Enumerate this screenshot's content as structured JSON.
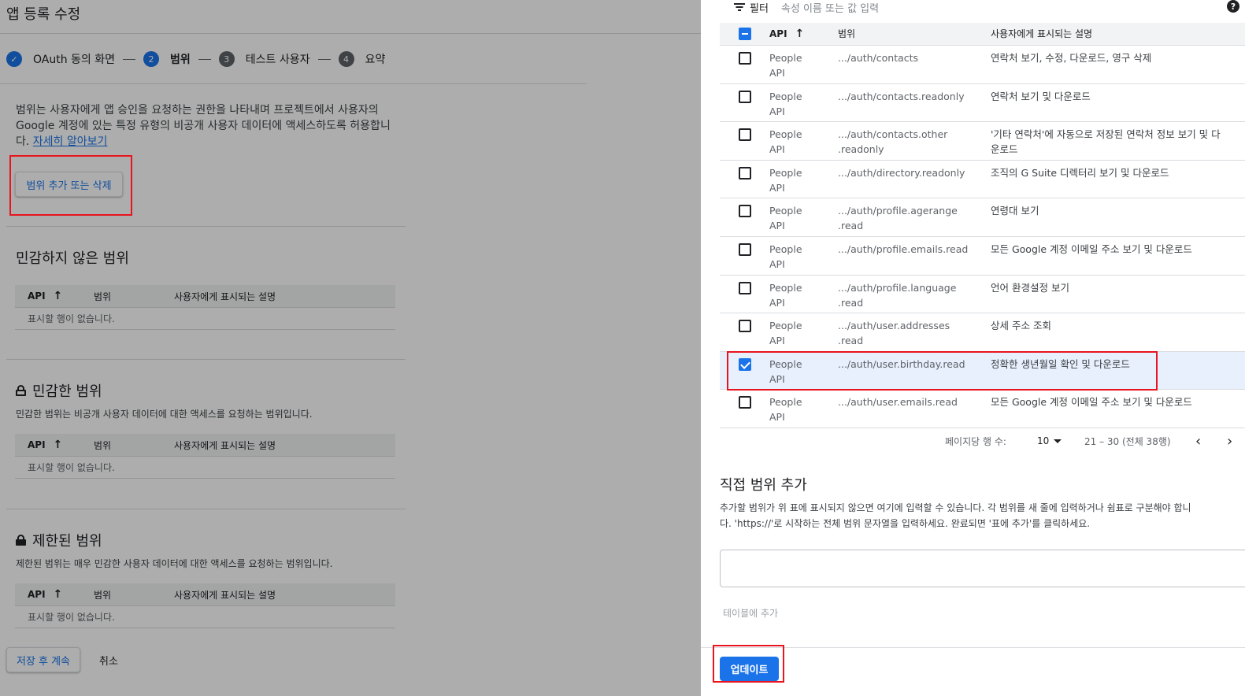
{
  "left": {
    "title": "앱 등록 수정",
    "steps": [
      {
        "num": "",
        "label": "OAuth 동의 화면",
        "state": "done"
      },
      {
        "num": "2",
        "label": "범위",
        "state": "active"
      },
      {
        "num": "3",
        "label": "테스트 사용자",
        "state": "todo"
      },
      {
        "num": "4",
        "label": "요약",
        "state": "todo"
      }
    ],
    "intro_text": "범위는 사용자에게 앱 승인을 요청하는 권한을 나타내며 프로젝트에서 사용자의 Google 계정에 있는 특정 유형의 비공개 사용자 데이터에 액세스하도록 허용합니다.",
    "learn_more": "자세히 알아보기",
    "add_remove_button": "범위 추가 또는 삭제",
    "table_headers": {
      "api": "API",
      "scope": "범위",
      "desc": "사용자에게 표시되는 설명"
    },
    "empty_text": "표시할 행이 없습니다.",
    "sections": {
      "non_sensitive": {
        "title": "민감하지 않은 범위",
        "desc": ""
      },
      "sensitive": {
        "title": "민감한 범위",
        "desc": "민감한 범위는 비공개 사용자 데이터에 대한 액세스를 요청하는 범위입니다."
      },
      "restricted": {
        "title": "제한된 범위",
        "desc": "제한된 범위는 매우 민감한 사용자 데이터에 대한 액세스를 요청하는 범위입니다."
      }
    },
    "save_button": "저장 후 계속",
    "cancel_button": "취소"
  },
  "panel": {
    "filter_label": "필터",
    "filter_placeholder": "속성 이름 또는 값 입력",
    "headers": {
      "api": "API",
      "scope": "범위",
      "desc": "사용자에게 표시되는 설명"
    },
    "rows": [
      {
        "api1": "People",
        "api2": "API",
        "scope1": ".../auth/contacts",
        "scope2": "",
        "desc1": "연락처 보기, 수정, 다운로드, 영구 삭제",
        "desc2": "",
        "checked": false
      },
      {
        "api1": "People",
        "api2": "API",
        "scope1": ".../auth/contacts.readonly",
        "scope2": "",
        "desc1": "연락처 보기 및 다운로드",
        "desc2": "",
        "checked": false
      },
      {
        "api1": "People",
        "api2": "API",
        "scope1": ".../auth/contacts.other",
        "scope2": ".readonly",
        "desc1": "'기타 연락처'에 자동으로 저장된 연락처 정보 보기 및 다",
        "desc2": "운로드",
        "checked": false
      },
      {
        "api1": "People",
        "api2": "API",
        "scope1": ".../auth/directory.readonly",
        "scope2": "",
        "desc1": "조직의 G Suite 디렉터리 보기 및 다운로드",
        "desc2": "",
        "checked": false
      },
      {
        "api1": "People",
        "api2": "API",
        "scope1": ".../auth/profile.agerange",
        "scope2": ".read",
        "desc1": "연령대 보기",
        "desc2": "",
        "checked": false
      },
      {
        "api1": "People",
        "api2": "API",
        "scope1": ".../auth/profile.emails.read",
        "scope2": "",
        "desc1": "모든 Google 계정 이메일 주소 보기 및 다운로드",
        "desc2": "",
        "checked": false
      },
      {
        "api1": "People",
        "api2": "API",
        "scope1": ".../auth/profile.language",
        "scope2": ".read",
        "desc1": "언어 환경설정 보기",
        "desc2": "",
        "checked": false
      },
      {
        "api1": "People",
        "api2": "API",
        "scope1": ".../auth/user.addresses",
        "scope2": ".read",
        "desc1": "상세 주소 조회",
        "desc2": "",
        "checked": false
      },
      {
        "api1": "People",
        "api2": "API",
        "scope1": ".../auth/user.birthday.read",
        "scope2": "",
        "desc1": "정확한 생년월일 확인 및 다운로드",
        "desc2": "",
        "checked": true
      },
      {
        "api1": "People",
        "api2": "API",
        "scope1": ".../auth/user.emails.read",
        "scope2": "",
        "desc1": "모든 Google 계정 이메일 주소 보기 및 다운로드",
        "desc2": "",
        "checked": false
      }
    ],
    "pager": {
      "rows_per_page_label": "페이지당 행 수:",
      "page_size": "10",
      "range": "21 – 30 (전체 38행)"
    },
    "manual": {
      "title": "직접 범위 추가",
      "desc_line1": "추가할 범위가 위 표에 표시되지 않으면 여기에 입력할 수 있습니다. 각 범위를 새 줄에 입력하거나 쉼표로 구분해야 합니",
      "desc_line2": "다. 'https://'로 시작하는 전체 범위 문자열을 입력하세요. 완료되면 '표에 추가'를 클릭하세요.",
      "add_to_table": "테이블에 추가"
    },
    "update_button": "업데이트"
  }
}
